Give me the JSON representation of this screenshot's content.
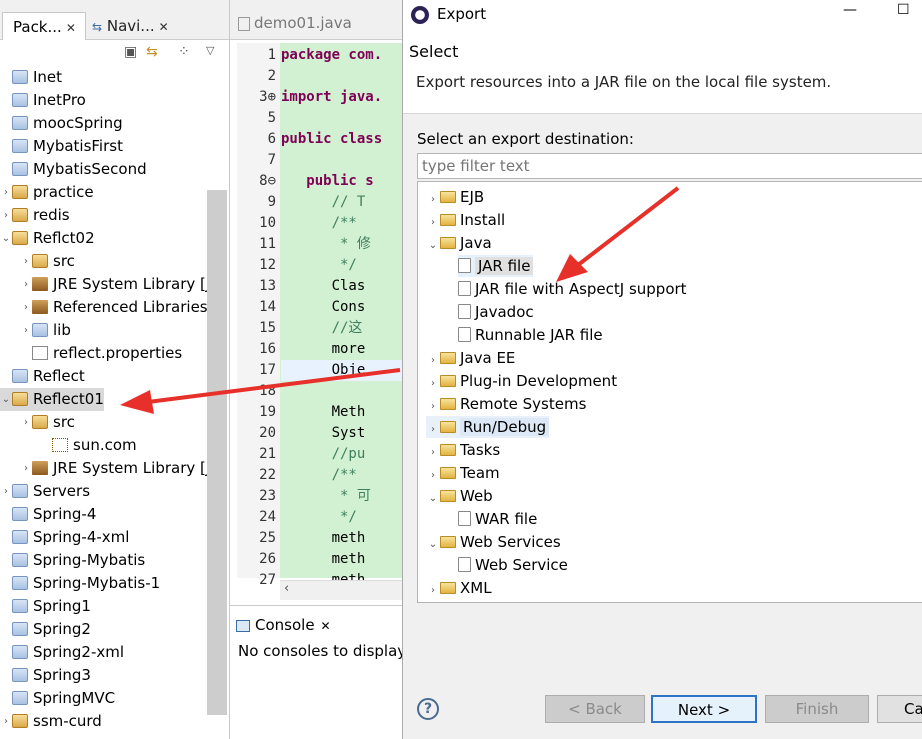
{
  "package_explorer": {
    "tab_active": "Pack...",
    "tab_inactive": "Navi...",
    "items": [
      {
        "label": "Inet",
        "icon": "folder-icon",
        "indent": 0
      },
      {
        "label": "InetPro",
        "icon": "folder-icon",
        "indent": 0
      },
      {
        "label": "moocSpring",
        "icon": "folder-icon",
        "indent": 0
      },
      {
        "label": "MybatisFirst",
        "icon": "folder-icon",
        "indent": 0
      },
      {
        "label": "MybatisSecond",
        "icon": "folder-icon",
        "indent": 0
      },
      {
        "label": "practice",
        "icon": "project-icon",
        "indent": 0
      },
      {
        "label": "redis",
        "icon": "project-icon",
        "indent": 0
      },
      {
        "label": "Reflct02",
        "icon": "project-icon",
        "indent": 0,
        "expanded": true
      },
      {
        "label": "src",
        "icon": "package-folder-icon",
        "indent": 1
      },
      {
        "label": "JRE System Library [Ja",
        "icon": "library-icon",
        "indent": 1
      },
      {
        "label": "Referenced Libraries",
        "icon": "library-icon",
        "indent": 1
      },
      {
        "label": "lib",
        "icon": "folder-icon",
        "indent": 1
      },
      {
        "label": "reflect.properties",
        "icon": "file-icon",
        "indent": 1
      },
      {
        "label": "Reflect",
        "icon": "folder-icon",
        "indent": 0
      },
      {
        "label": "Reflect01",
        "icon": "project-icon",
        "indent": 0,
        "expanded": true,
        "selected": true
      },
      {
        "label": "src",
        "icon": "package-folder-icon",
        "indent": 1
      },
      {
        "label": "sun.com",
        "icon": "package-icon",
        "indent": 2
      },
      {
        "label": "JRE System Library [Ja",
        "icon": "library-icon",
        "indent": 1
      },
      {
        "label": "Servers",
        "icon": "folder-icon",
        "indent": 0
      },
      {
        "label": "Spring-4",
        "icon": "folder-icon",
        "indent": 0
      },
      {
        "label": "Spring-4-xml",
        "icon": "folder-icon",
        "indent": 0
      },
      {
        "label": "Spring-Mybatis",
        "icon": "folder-icon",
        "indent": 0
      },
      {
        "label": "Spring-Mybatis-1",
        "icon": "folder-icon",
        "indent": 0
      },
      {
        "label": "Spring1",
        "icon": "folder-icon",
        "indent": 0
      },
      {
        "label": "Spring2",
        "icon": "folder-icon",
        "indent": 0
      },
      {
        "label": "Spring2-xml",
        "icon": "folder-icon",
        "indent": 0
      },
      {
        "label": "Spring3",
        "icon": "folder-icon",
        "indent": 0
      },
      {
        "label": "SpringMVC",
        "icon": "folder-icon",
        "indent": 0
      },
      {
        "label": "ssm-curd",
        "icon": "project-icon",
        "indent": 0
      }
    ]
  },
  "editor": {
    "tab_label": "demo01.java",
    "lines": [
      {
        "n": "1",
        "text": "package com.",
        "style": "kw-start"
      },
      {
        "n": "2",
        "text": ""
      },
      {
        "n": "3⊕",
        "text": "import java.",
        "style": "kw-start"
      },
      {
        "n": "5",
        "text": ""
      },
      {
        "n": "6",
        "text": "public class",
        "style": "kw"
      },
      {
        "n": "7",
        "text": ""
      },
      {
        "n": "8⊖",
        "text": "   public s",
        "style": "kw"
      },
      {
        "n": "9",
        "text": "      // T",
        "style": "cm"
      },
      {
        "n": "10",
        "text": "      /**",
        "style": "cm"
      },
      {
        "n": "11",
        "text": "       * 修",
        "style": "cm"
      },
      {
        "n": "12",
        "text": "       */",
        "style": "cm"
      },
      {
        "n": "13",
        "text": "      Clas"
      },
      {
        "n": "14",
        "text": "      Cons"
      },
      {
        "n": "15",
        "text": "      //这",
        "style": "cm"
      },
      {
        "n": "16",
        "text": "      more"
      },
      {
        "n": "17",
        "text": "      Obje",
        "style": "hl"
      },
      {
        "n": "18",
        "text": ""
      },
      {
        "n": "19",
        "text": "      Meth"
      },
      {
        "n": "20",
        "text": "      Syst"
      },
      {
        "n": "21",
        "text": "      //pu",
        "style": "cm"
      },
      {
        "n": "22",
        "text": "      /**",
        "style": "cm"
      },
      {
        "n": "23",
        "text": "       * 可",
        "style": "cm"
      },
      {
        "n": "24",
        "text": "       */",
        "style": "cm"
      },
      {
        "n": "25",
        "text": "      meth"
      },
      {
        "n": "26",
        "text": "      meth"
      },
      {
        "n": "27",
        "text": "      meth"
      }
    ]
  },
  "console": {
    "tab_label": "Console",
    "message": "No consoles to display"
  },
  "dialog": {
    "title": "Export",
    "header_title": "Select",
    "header_desc": "Export resources into a JAR file on the local file system.",
    "dest_label": "Select an export destination:",
    "filter_placeholder": "type filter text",
    "tree": [
      {
        "label": "EJB",
        "level": 0,
        "expanded": false
      },
      {
        "label": "Install",
        "level": 0,
        "expanded": false
      },
      {
        "label": "Java",
        "level": 0,
        "expanded": true
      },
      {
        "label": "JAR file",
        "level": 1,
        "selected": true
      },
      {
        "label": "JAR file with AspectJ support",
        "level": 1
      },
      {
        "label": "Javadoc",
        "level": 1
      },
      {
        "label": "Runnable JAR file",
        "level": 1
      },
      {
        "label": "Java EE",
        "level": 0,
        "expanded": false
      },
      {
        "label": "Plug-in Development",
        "level": 0,
        "expanded": false
      },
      {
        "label": "Remote Systems",
        "level": 0,
        "expanded": false
      },
      {
        "label": "Run/Debug",
        "level": 0,
        "expanded": false,
        "hover": true
      },
      {
        "label": "Tasks",
        "level": 0,
        "expanded": false
      },
      {
        "label": "Team",
        "level": 0,
        "expanded": false
      },
      {
        "label": "Web",
        "level": 0,
        "expanded": true
      },
      {
        "label": "WAR file",
        "level": 1
      },
      {
        "label": "Web Services",
        "level": 0,
        "expanded": true
      },
      {
        "label": "Web Service",
        "level": 1
      },
      {
        "label": "XML",
        "level": 0,
        "expanded": false
      }
    ],
    "buttons": {
      "back": "< Back",
      "next": "Next >",
      "finish": "Finish",
      "cancel": "Ca"
    }
  },
  "colors": {
    "arrow": "#e8302a",
    "selection_blue": "#e5f1fb",
    "editor_green": "#d2f0d2"
  }
}
